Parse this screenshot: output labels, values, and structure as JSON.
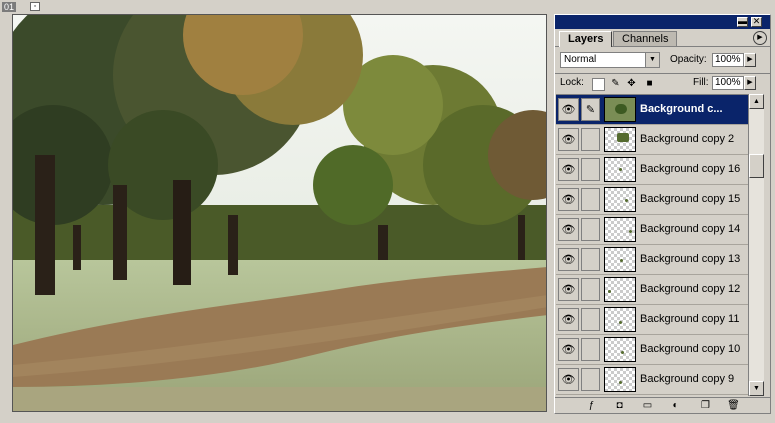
{
  "document": {
    "number_badge": "01",
    "icon": "document-window-icon"
  },
  "layers_panel": {
    "tabs": [
      {
        "label": "Layers",
        "active": true
      },
      {
        "label": "Channels",
        "active": false
      }
    ],
    "blend_mode": "Normal",
    "opacity_label": "Opacity:",
    "opacity_value": "100%",
    "lock_label": "Lock:",
    "fill_label": "Fill:",
    "fill_value": "100%",
    "layers": [
      {
        "name": "Background c...",
        "selected": true
      },
      {
        "name": "Background copy 2",
        "selected": false
      },
      {
        "name": "Background copy 16",
        "selected": false
      },
      {
        "name": "Background copy 15",
        "selected": false
      },
      {
        "name": "Background copy 14",
        "selected": false
      },
      {
        "name": "Background copy 13",
        "selected": false
      },
      {
        "name": "Background copy 12",
        "selected": false
      },
      {
        "name": "Background copy 11",
        "selected": false
      },
      {
        "name": "Background copy 10",
        "selected": false
      },
      {
        "name": "Background copy 9",
        "selected": false
      }
    ],
    "bottom_icons": [
      "layer-style-icon",
      "layer-mask-icon",
      "layer-set-icon",
      "adjustment-layer-icon",
      "new-layer-icon",
      "trash-icon"
    ],
    "colors": {
      "titlebar": "#0a246a",
      "selection": "#0a246a",
      "panel_bg": "#d4d0c8"
    }
  }
}
